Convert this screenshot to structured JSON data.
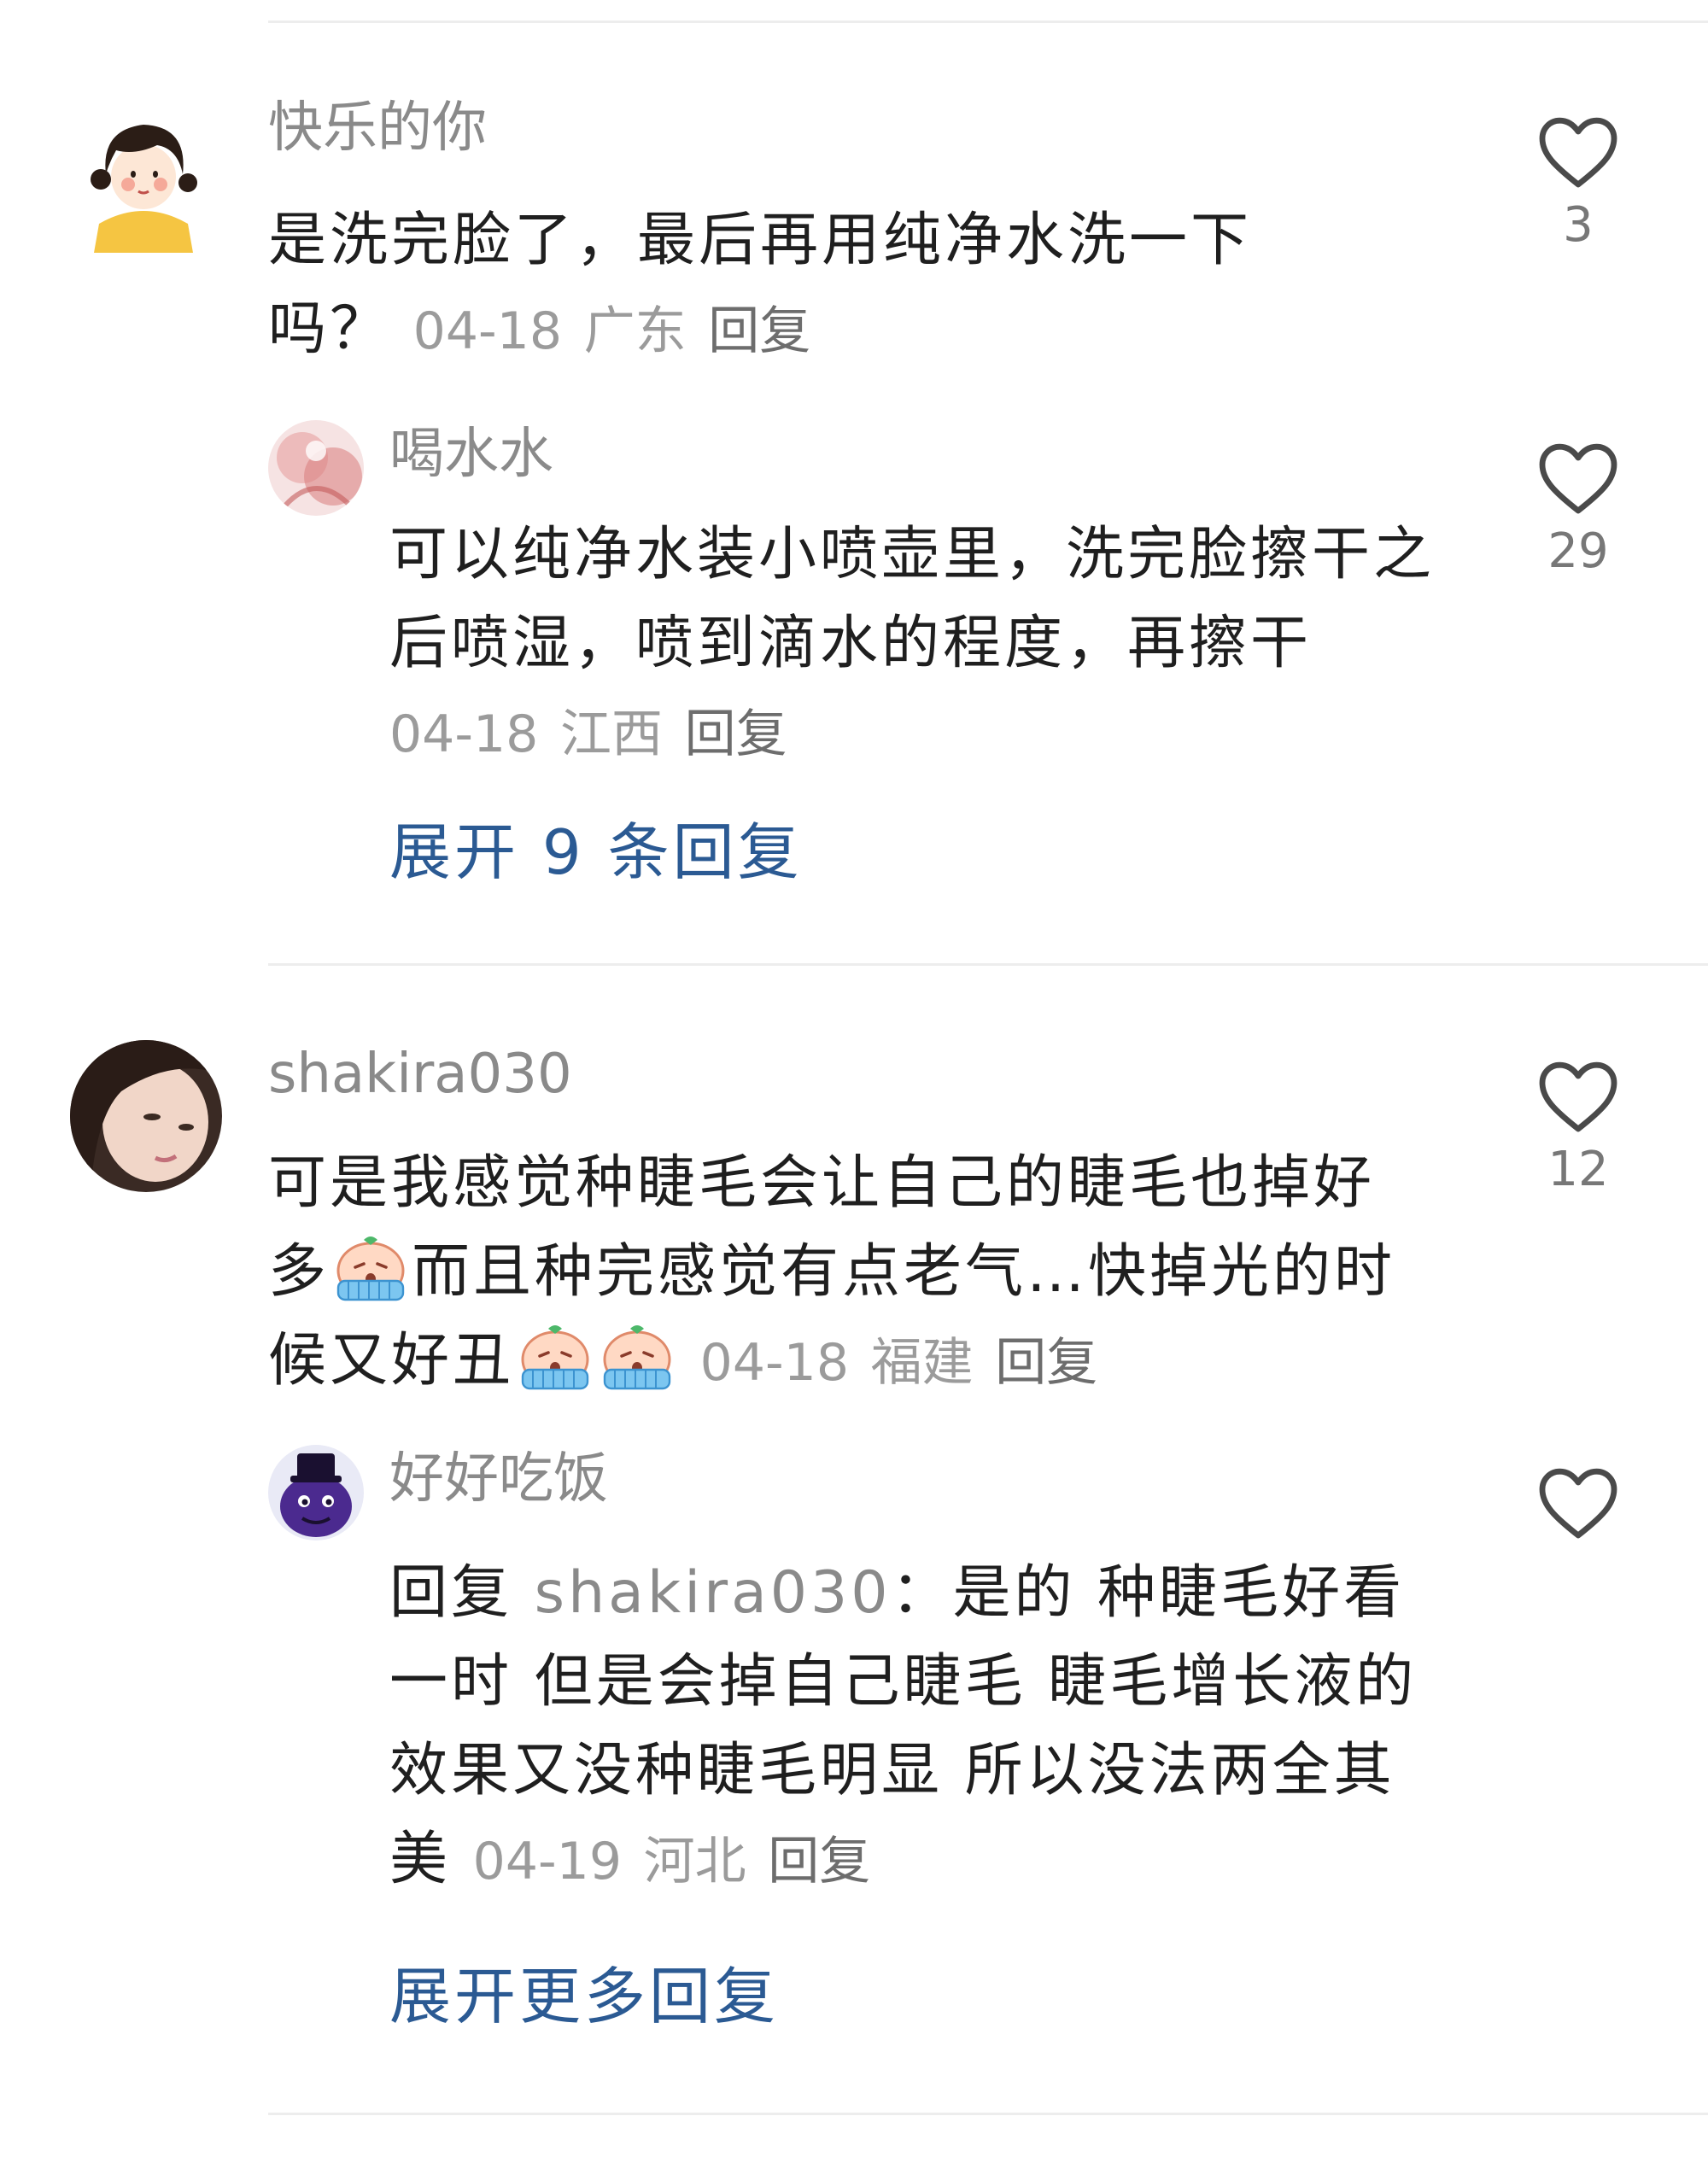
{
  "comments": [
    {
      "username": "快乐的你",
      "text": "是洗完脸了，最后再用纯净水洗一下吗？",
      "date": "04-18",
      "location": "广东",
      "reply_label": "回复",
      "likes": "3",
      "replies": [
        {
          "username": "喝水水",
          "text": "可以纯净水装小喷壶里，洗完脸擦干之后喷湿，喷到滴水的程度，再擦干",
          "date": "04-18",
          "location": "江西",
          "reply_label": "回复",
          "likes": "29"
        }
      ],
      "expand_label": "展开 9 条回复"
    },
    {
      "username": "shakira030",
      "text_part1": "可是我感觉种睫毛会让自己的睫毛也掉好多",
      "text_part2": "而且种完感觉有点老气…快掉光的时候又好丑",
      "date": "04-18",
      "location": "福建",
      "reply_label": "回复",
      "likes": "12",
      "emoji_icon": "crying-face-emoji",
      "replies": [
        {
          "username": "好好吃饭",
          "reply_prefix": "回复",
          "mention": "shakira030",
          "text": "：是的 种睫毛好看一时 但是会掉自己睫毛 睫毛增长液的效果又没种睫毛明显 所以没法两全其美",
          "date": "04-19",
          "location": "河北",
          "reply_label": "回复"
        }
      ],
      "expand_label": "展开更多回复"
    }
  ],
  "colors": {
    "username": "#8a8a8a",
    "meta": "#9b9b9b",
    "expand_link": "#2b5a93",
    "divider": "#ededed"
  }
}
